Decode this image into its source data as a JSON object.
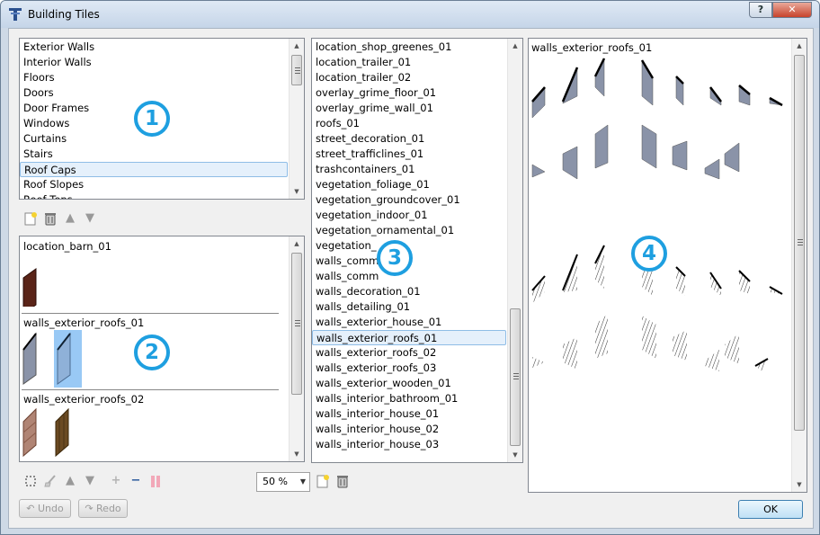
{
  "window": {
    "title": "Building Tiles",
    "help": "?",
    "close": "✕"
  },
  "categories": {
    "items": [
      "Exterior Walls",
      "Interior Walls",
      "Floors",
      "Doors",
      "Door Frames",
      "Windows",
      "Curtains",
      "Stairs",
      "Roof Caps",
      "Roof Slopes",
      "Roof Tops"
    ],
    "selected": "Roof Caps"
  },
  "tilesets_in_category": [
    {
      "name": "location_barn_01"
    },
    {
      "name": "walls_exterior_roofs_01"
    },
    {
      "name": "walls_exterior_roofs_02"
    }
  ],
  "tilesets": {
    "items": [
      "location_shop_greenes_01",
      "location_trailer_01",
      "location_trailer_02",
      "overlay_grime_floor_01",
      "overlay_grime_wall_01",
      "roofs_01",
      "street_decoration_01",
      "street_trafficlines_01",
      "trashcontainers_01",
      "vegetation_foliage_01",
      "vegetation_groundcover_01",
      "vegetation_indoor_01",
      "vegetation_ornamental_01",
      "vegetation_",
      "walls_comm",
      "walls_comm",
      "walls_decoration_01",
      "walls_detailing_01",
      "walls_exterior_house_01",
      "walls_exterior_roofs_01",
      "walls_exterior_roofs_02",
      "walls_exterior_roofs_03",
      "walls_exterior_wooden_01",
      "walls_interior_bathroom_01",
      "walls_interior_house_01",
      "walls_interior_house_02",
      "walls_interior_house_03"
    ],
    "selected": "walls_exterior_roofs_01"
  },
  "preview": {
    "title": "walls_exterior_roofs_01"
  },
  "callouts": [
    "1",
    "2",
    "3",
    "4"
  ],
  "zoom": {
    "value": "50 %",
    "options": [
      "50 %"
    ]
  },
  "buttons": {
    "undo": "Undo",
    "redo": "Redo",
    "ok": "OK"
  },
  "icons": {
    "category_toolbar": [
      "new-icon",
      "delete-icon",
      "move-up-icon",
      "move-down-icon"
    ],
    "tile_toolbar": [
      "select-rect-icon",
      "clear-icon",
      "move-up-icon",
      "move-down-icon",
      "add-icon",
      "remove-icon",
      "color-bars-icon"
    ],
    "tileset_toolbar": [
      "new-icon",
      "delete-icon"
    ]
  },
  "colors": {
    "accent": "#1e9fe0",
    "selection": "#e5f0fb",
    "window_chrome": "#ced9e6"
  }
}
